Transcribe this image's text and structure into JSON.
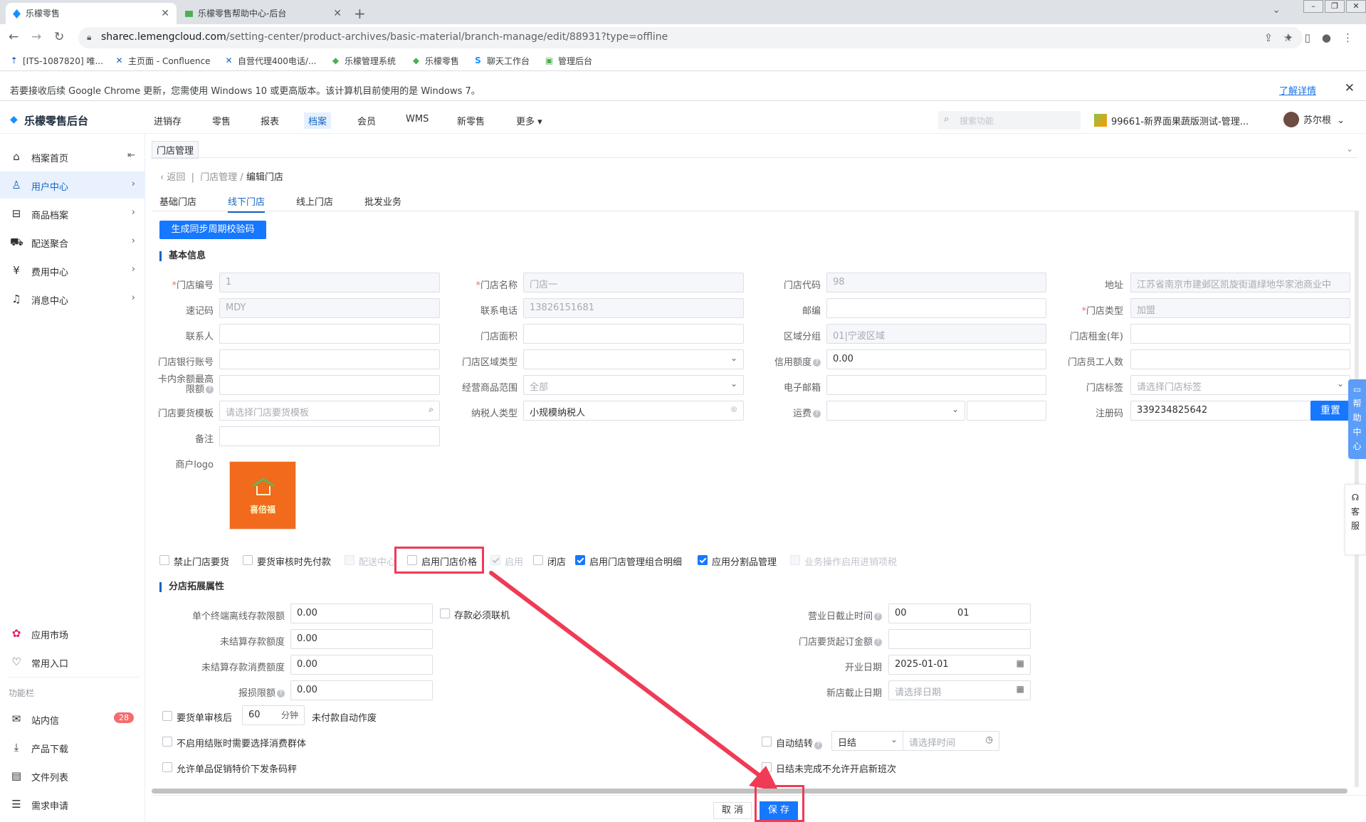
{
  "browser": {
    "tabs": [
      {
        "title": "乐檬零售",
        "active": true
      },
      {
        "title": "乐檬零售帮助中心-后台",
        "active": false
      }
    ],
    "url_host": "sharec.lemengcloud.com",
    "url_path": "/setting-center/product-archives/basic-material/branch-manage/edit/88931?type=offline",
    "bookmarks": [
      "[ITS-1087820] 唯...",
      "主页面 - Confluence",
      "自营代理400电话/...",
      "乐檬管理系统",
      "乐檬零售",
      "聊天工作台",
      "管理后台"
    ],
    "infobar": {
      "message": "若要接收后续 Google Chrome 更新，您需使用 Windows 10 或更高版本。该计算机目前使用的是 Windows 7。",
      "link": "了解详情"
    }
  },
  "app": {
    "logo": "乐檬零售后台",
    "menu": [
      "进销存",
      "零售",
      "报表",
      "档案",
      "会员",
      "WMS",
      "新零售",
      "更多"
    ],
    "active_menu": "档案",
    "search_placeholder": "搜索功能",
    "store": "99661-新界面果蔬版测试-管理...",
    "user": "苏尔根"
  },
  "sidebar": {
    "items": [
      "档案首页",
      "用户中心",
      "商品档案",
      "配送聚合",
      "费用中心",
      "消息中心"
    ],
    "active": "用户中心",
    "bottom": [
      "应用市场",
      "常用入口"
    ],
    "section_label": "功能栏",
    "tools": [
      "站内信",
      "产品下载",
      "文件列表",
      "需求申请"
    ],
    "inbox_badge": "28"
  },
  "page": {
    "tab": "门店管理",
    "breadcrumb": {
      "back": "返回",
      "parent": "门店管理",
      "current": "编辑门店"
    },
    "subtabs": [
      "基础门店",
      "线下门店",
      "线上门店",
      "批发业务"
    ],
    "active_subtab": "线下门店",
    "gen_button": "生成同步周期校验码",
    "section_basic": "基本信息",
    "section_ext": "分店拓展属性",
    "reset_button": "重置",
    "logo_label": "商户logo",
    "logo_text": "喜倍福",
    "cancel": "取 消",
    "save": "保 存"
  },
  "fields": {
    "store_no": {
      "label": "门店编号",
      "value": "1"
    },
    "store_name": {
      "label": "门店名称",
      "value": "门店一"
    },
    "store_code": {
      "label": "门店代码",
      "value": "98"
    },
    "address": {
      "label": "地址",
      "value": "江苏省南京市建邺区凯旋街道绿地华家池商业中"
    },
    "mnemonic": {
      "label": "速记码",
      "value": "MDY"
    },
    "phone": {
      "label": "联系电话",
      "value": "13826151681"
    },
    "postcode": {
      "label": "邮编",
      "value": ""
    },
    "store_type": {
      "label": "门店类型",
      "value": "加盟"
    },
    "contact": {
      "label": "联系人",
      "value": ""
    },
    "area": {
      "label": "门店面积",
      "value": ""
    },
    "region_group": {
      "label": "区域分组",
      "value": "01|宁波区域"
    },
    "rent": {
      "label": "门店租金(年)",
      "value": ""
    },
    "bank_account": {
      "label": "门店银行账号",
      "value": ""
    },
    "region_type": {
      "label": "门店区域类型",
      "value": ""
    },
    "credit": {
      "label": "信用额度",
      "value": "0.00"
    },
    "staff": {
      "label": "门店员工人数",
      "value": ""
    },
    "card_max_1": "卡内余额最高",
    "card_max_2": "限额",
    "card_max": "",
    "scope": {
      "label": "经营商品范围",
      "value": "全部"
    },
    "email": {
      "label": "电子邮箱",
      "value": ""
    },
    "tags": {
      "label": "门店标签",
      "placeholder": "请选择门店标签"
    },
    "order_tpl": {
      "label": "门店要货模板",
      "placeholder": "请选择门店要货模板"
    },
    "taxpayer": {
      "label": "纳税人类型",
      "value": "小规模纳税人"
    },
    "freight": {
      "label": "运费",
      "value": ""
    },
    "reg_code": {
      "label": "注册码",
      "value": "339234825642"
    },
    "remark": {
      "label": "备注",
      "value": ""
    }
  },
  "checkboxes": [
    {
      "label": "禁止门店要货",
      "state": "off"
    },
    {
      "label": "要货审核时先付款",
      "state": "off"
    },
    {
      "label": "配送中心",
      "state": "disabled"
    },
    {
      "label": "启用门店价格",
      "state": "off"
    },
    {
      "label": "启用",
      "state": "disabled-on"
    },
    {
      "label": "闭店",
      "state": "off"
    },
    {
      "label": "启用门店管理组合明细",
      "state": "on"
    },
    {
      "label": "应用分割品管理",
      "state": "on"
    },
    {
      "label": "业务操作启用进销项税",
      "state": "disabled"
    }
  ],
  "ext": {
    "offline_limit": {
      "label": "单个终端离线存款限额",
      "value": "0.00"
    },
    "must_online": "存款必须联机",
    "unsettled_amount": {
      "label": "未结算存款额度",
      "value": "0.00"
    },
    "unsettled_consume": {
      "label": "未结算存款消费额度",
      "value": "0.00"
    },
    "loss_limit": {
      "label": "报损限额",
      "value": "0.00"
    },
    "biz_cutoff": {
      "label": "营业日截止时间",
      "hour": "00",
      "minute": "01"
    },
    "min_order": {
      "label": "门店要货起订金额",
      "value": ""
    },
    "open_date": {
      "label": "开业日期",
      "value": "2025-01-01"
    },
    "new_store_end": {
      "label": "新店截止日期",
      "placeholder": "请选择日期"
    },
    "order_after": "要货单审核后",
    "minutes": "60",
    "minute_unit": "分钟",
    "auto_void": "未付款自动作废",
    "no_consumer_group": "不启用结账时需要选择消费群体",
    "allow_promo_code": "允许单品促销特价下发条码秤",
    "auto_shift": "自动结转",
    "shift_type": "日结",
    "shift_time_ph": "请选择时间",
    "no_new_shift": "日结未完成不允许开启新班次"
  },
  "floating": {
    "help": [
      "帮",
      "助",
      "中",
      "心"
    ],
    "service": [
      "客",
      "服"
    ]
  },
  "colors": {
    "primary": "#1677ff",
    "highlight": "#ef3b55",
    "danger": "#f56c6c"
  }
}
